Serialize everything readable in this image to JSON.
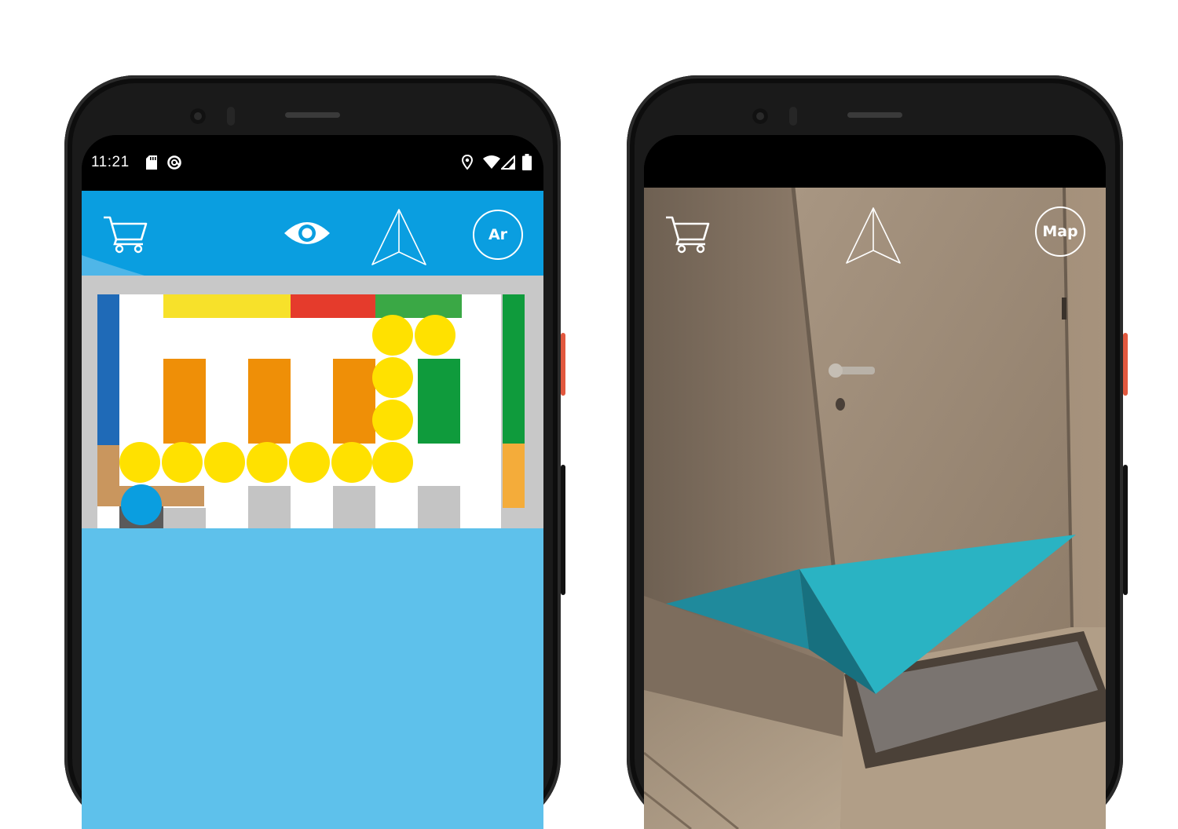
{
  "left_phone": {
    "status_bar": {
      "time": "11:21",
      "left_icons": [
        "sd-card-icon",
        "sync-icon"
      ],
      "right_icons": [
        "location-icon",
        "wifi-icon",
        "signal-icon",
        "battery-icon"
      ]
    },
    "app_bar": {
      "background": "#0a9ee0",
      "buttons": [
        "cart-icon",
        "eye-icon",
        "navigation-arrow-icon"
      ],
      "ar_button_label": "Ar"
    },
    "store_map": {
      "background": "#c8c8c8",
      "floor_color": "#ffffff",
      "shelf_colors": {
        "yellow": "#f7e12a",
        "red": "#e53b2c",
        "green": "#3aa845",
        "dark_green": "#0f9b3c",
        "blue": "#1f6ab7",
        "orange": "#ef8f07",
        "tan": "#c9965e",
        "light_orange": "#f4ac3a",
        "grey": "#c4c4c4"
      },
      "path_color": "#ffe100",
      "user_position_color": "#0a9ee0",
      "path_dot_count": 11
    },
    "lower_panel_color": "#5ec1eb"
  },
  "right_phone": {
    "app_bar": {
      "buttons": [
        "cart-icon",
        "navigation-arrow-icon"
      ],
      "map_button_label": "Map"
    },
    "ar_arrow_color": "#2ab3c3"
  }
}
